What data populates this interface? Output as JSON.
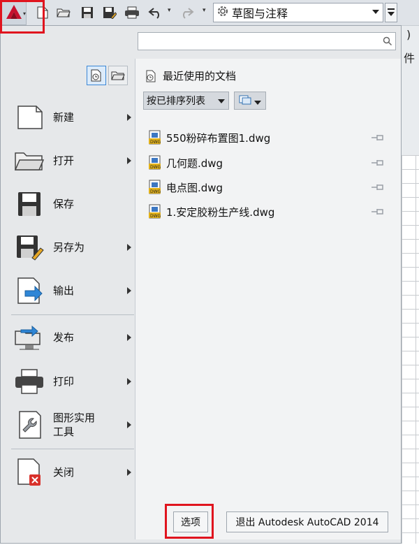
{
  "toolbar": {
    "workspace_label": "草图与注释",
    "icons": [
      "application-logo-icon",
      "new-file-icon",
      "open-folder-icon",
      "save-icon",
      "save-as-icon",
      "print-icon",
      "undo-icon",
      "redo-icon",
      "gear-icon"
    ]
  },
  "background": {
    "title_fragment": "件",
    "paren_fragment": ")"
  },
  "search": {
    "placeholder": "",
    "value": ""
  },
  "left_menu": {
    "items": [
      {
        "label": "新建",
        "has_submenu": true
      },
      {
        "label": "打开",
        "has_submenu": true
      },
      {
        "label": "保存",
        "has_submenu": false
      },
      {
        "label": "另存为",
        "has_submenu": true
      },
      {
        "label": "输出",
        "has_submenu": true
      },
      {
        "label": "发布",
        "has_submenu": true
      },
      {
        "label": "打印",
        "has_submenu": true
      },
      {
        "label": "图形实用\n工具",
        "has_submenu": true
      },
      {
        "label": "关闭",
        "has_submenu": true
      }
    ]
  },
  "recent": {
    "header": "最近使用的文档",
    "sort_label": "按已排序列表",
    "documents": [
      "550粉碎布置图1.dwg",
      "几何题.dwg",
      "电点图.dwg",
      "1.安定胶粉生产线.dwg"
    ]
  },
  "footer": {
    "options_label": "选项",
    "exit_label": "退出 Autodesk AutoCAD 2014"
  },
  "colors": {
    "highlight": "#e0141e",
    "accent": "#3b87d6",
    "autocad_red": "#c8102e"
  }
}
